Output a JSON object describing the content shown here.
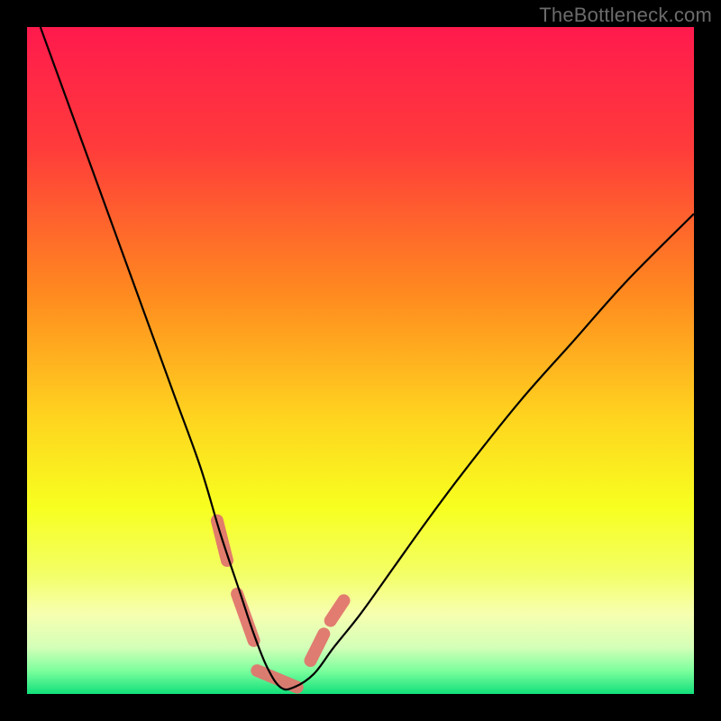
{
  "watermark": "TheBottleneck.com",
  "colors": {
    "background": "#000000",
    "gradient_stops": [
      {
        "offset": 0.0,
        "color": "#ff1a4d"
      },
      {
        "offset": 0.18,
        "color": "#ff3b3b"
      },
      {
        "offset": 0.4,
        "color": "#ff8a1f"
      },
      {
        "offset": 0.58,
        "color": "#ffd21f"
      },
      {
        "offset": 0.72,
        "color": "#f7ff1f"
      },
      {
        "offset": 0.82,
        "color": "#f3ff66"
      },
      {
        "offset": 0.88,
        "color": "#f7ffb0"
      },
      {
        "offset": 0.93,
        "color": "#d4ffb8"
      },
      {
        "offset": 0.965,
        "color": "#7dff9e"
      },
      {
        "offset": 1.0,
        "color": "#12e07a"
      }
    ],
    "curve": "#000000",
    "marker": "#e0756e"
  },
  "chart_data": {
    "type": "line",
    "title": "",
    "xlabel": "",
    "ylabel": "",
    "xlim": [
      0,
      100
    ],
    "ylim": [
      0,
      100
    ],
    "grid": false,
    "series": [
      {
        "name": "bottleneck-curve",
        "x": [
          2,
          6,
          10,
          14,
          18,
          22,
          26,
          29,
          32,
          34,
          36,
          38,
          40,
          43,
          46,
          50,
          55,
          60,
          66,
          74,
          82,
          90,
          100
        ],
        "y": [
          100,
          89,
          78,
          67,
          56,
          45,
          34,
          24,
          15,
          9,
          4,
          1,
          1,
          3,
          7,
          12,
          19,
          26,
          34,
          44,
          53,
          62,
          72
        ]
      }
    ],
    "markers": [
      {
        "name": "highlight-left-1",
        "segment": {
          "x": [
            28.5,
            30.0
          ],
          "y": [
            26,
            20
          ]
        }
      },
      {
        "name": "highlight-left-2",
        "segment": {
          "x": [
            31.5,
            34.0
          ],
          "y": [
            15,
            8
          ]
        }
      },
      {
        "name": "highlight-bottom",
        "segment": {
          "x": [
            34.5,
            40.5
          ],
          "y": [
            3.5,
            1.0
          ]
        }
      },
      {
        "name": "highlight-right-1",
        "segment": {
          "x": [
            42.5,
            44.5
          ],
          "y": [
            5,
            9
          ]
        }
      },
      {
        "name": "highlight-right-2",
        "segment": {
          "x": [
            45.5,
            47.5
          ],
          "y": [
            11,
            14
          ]
        }
      }
    ]
  }
}
